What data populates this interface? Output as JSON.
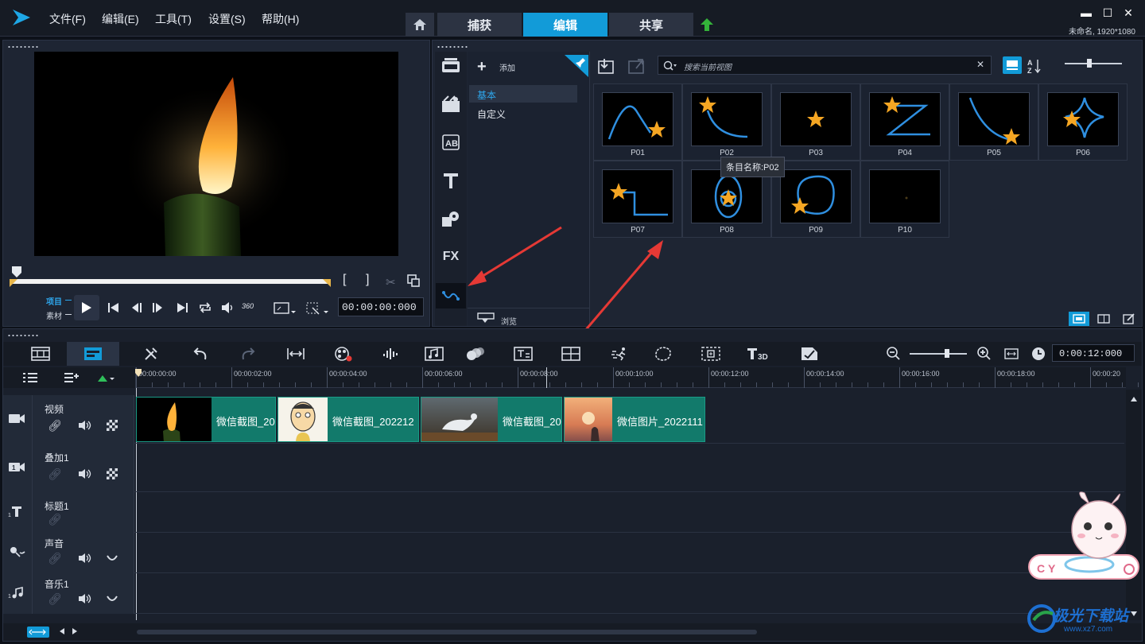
{
  "menu": [
    "文件(F)",
    "编辑(E)",
    "工具(T)",
    "设置(S)",
    "帮助(H)"
  ],
  "tabs": [
    {
      "label": "捕获"
    },
    {
      "label": "编辑"
    },
    {
      "label": "共享"
    }
  ],
  "project_info": "未命名, 1920*1080",
  "preview": {
    "project_label": "项目",
    "clip_label": "素材",
    "timecode": "00:00:00:000",
    "mark_in": "[",
    "mark_out": "]"
  },
  "library": {
    "add_label": "添加",
    "categories": [
      "基本",
      "自定义"
    ],
    "browse_label": "浏览",
    "search_placeholder": "搜索当前视图",
    "items": [
      "P01",
      "P02",
      "P03",
      "P04",
      "P05",
      "P06",
      "P07",
      "P08",
      "P09",
      "P10"
    ],
    "tooltip": "条目名称:P02"
  },
  "sidebar_icons": [
    "media-icon",
    "instant-project-icon",
    "transition-icon",
    "title-icon",
    "graphic-icon",
    "filter-icon",
    "path-icon"
  ],
  "sidebar_fx_label": "FX",
  "timeline": {
    "zoom_time": "0:00:12:000",
    "ruler": [
      "00:00:00:00",
      "00:00:02:00",
      "00:00:04:00",
      "00:00:06:00",
      "00:00:08:00",
      "00:00:10:00",
      "00:00:12:00",
      "00:00:14:00",
      "00:00:16:00",
      "00:00:18:00",
      "00:00:20"
    ],
    "tracks": [
      {
        "name": "视频"
      },
      {
        "name": "叠加1"
      },
      {
        "name": "标题1"
      },
      {
        "name": "声音"
      },
      {
        "name": "音乐1"
      }
    ],
    "clips": [
      "微信截图_20",
      "微信截图_202212",
      "微信截图_20",
      "微信图片_2022111"
    ]
  },
  "watermark": "极光下载站",
  "watermark_url": "www.xz7.com",
  "colors": {
    "accent": "#129bd8",
    "clip": "#127a6b",
    "arrow": "#e53935",
    "star": "#f5a623",
    "path": "#2f8fe0"
  }
}
